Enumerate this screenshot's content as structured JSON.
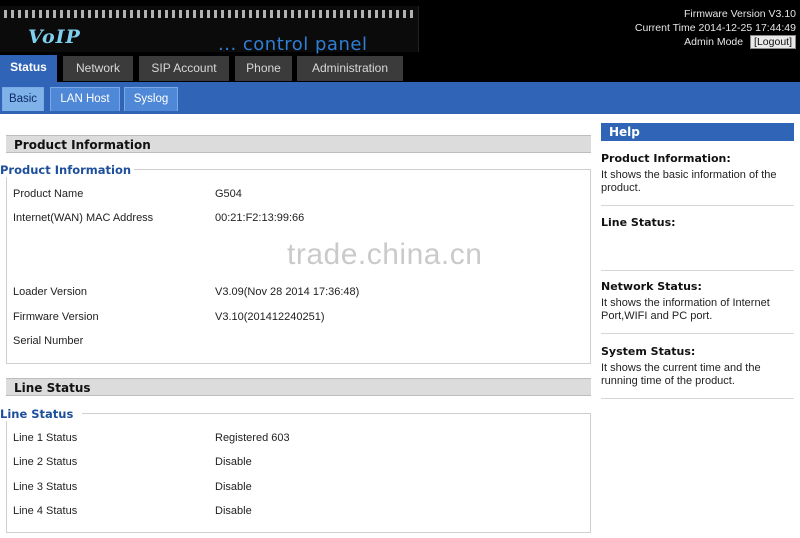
{
  "header": {
    "logo_text": "VoIP",
    "logo_subtitle": "... control panel",
    "firmware": "Firmware Version V3.10",
    "current_time": "Current Time 2014-12-25 17:44:49",
    "mode": "Admin Mode",
    "logout_label": "[Logout]"
  },
  "tabs": [
    {
      "label": "Status"
    },
    {
      "label": "Network"
    },
    {
      "label": "SIP Account"
    },
    {
      "label": "Phone"
    },
    {
      "label": "Administration"
    }
  ],
  "subtabs": [
    {
      "label": "Basic"
    },
    {
      "label": "LAN Host"
    },
    {
      "label": "Syslog"
    }
  ],
  "product": {
    "section_title": "Product Information",
    "legend": "Product Information",
    "rows": [
      {
        "label": "Product Name",
        "value": "G504"
      },
      {
        "label": "Internet(WAN) MAC Address",
        "value": "00:21:F2:13:99:66"
      },
      {
        "label": "Loader Version",
        "value": "V3.09(Nov 28 2014 17:36:48)"
      },
      {
        "label": "Firmware Version",
        "value": "V3.10(201412240251)"
      },
      {
        "label": "Serial Number",
        "value": ""
      }
    ]
  },
  "line": {
    "section_title": "Line Status",
    "legend": "Line Status",
    "rows": [
      {
        "label": "Line 1 Status",
        "value": "Registered 603"
      },
      {
        "label": "Line 2 Status",
        "value": "Disable"
      },
      {
        "label": "Line 3 Status",
        "value": "Disable"
      },
      {
        "label": "Line 4 Status",
        "value": "Disable"
      }
    ]
  },
  "watermark": "trade.china.cn",
  "help": {
    "title": "Help",
    "items": [
      {
        "title": "Product Information:",
        "text": "It shows the basic information of the product."
      },
      {
        "title": "Line Status:",
        "text": ""
      },
      {
        "title": "Network Status:",
        "text": "It shows the information of Internet Port,WIFI and PC port."
      },
      {
        "title": "System Status:",
        "text": "It shows the current time and the running time of the product."
      }
    ]
  }
}
